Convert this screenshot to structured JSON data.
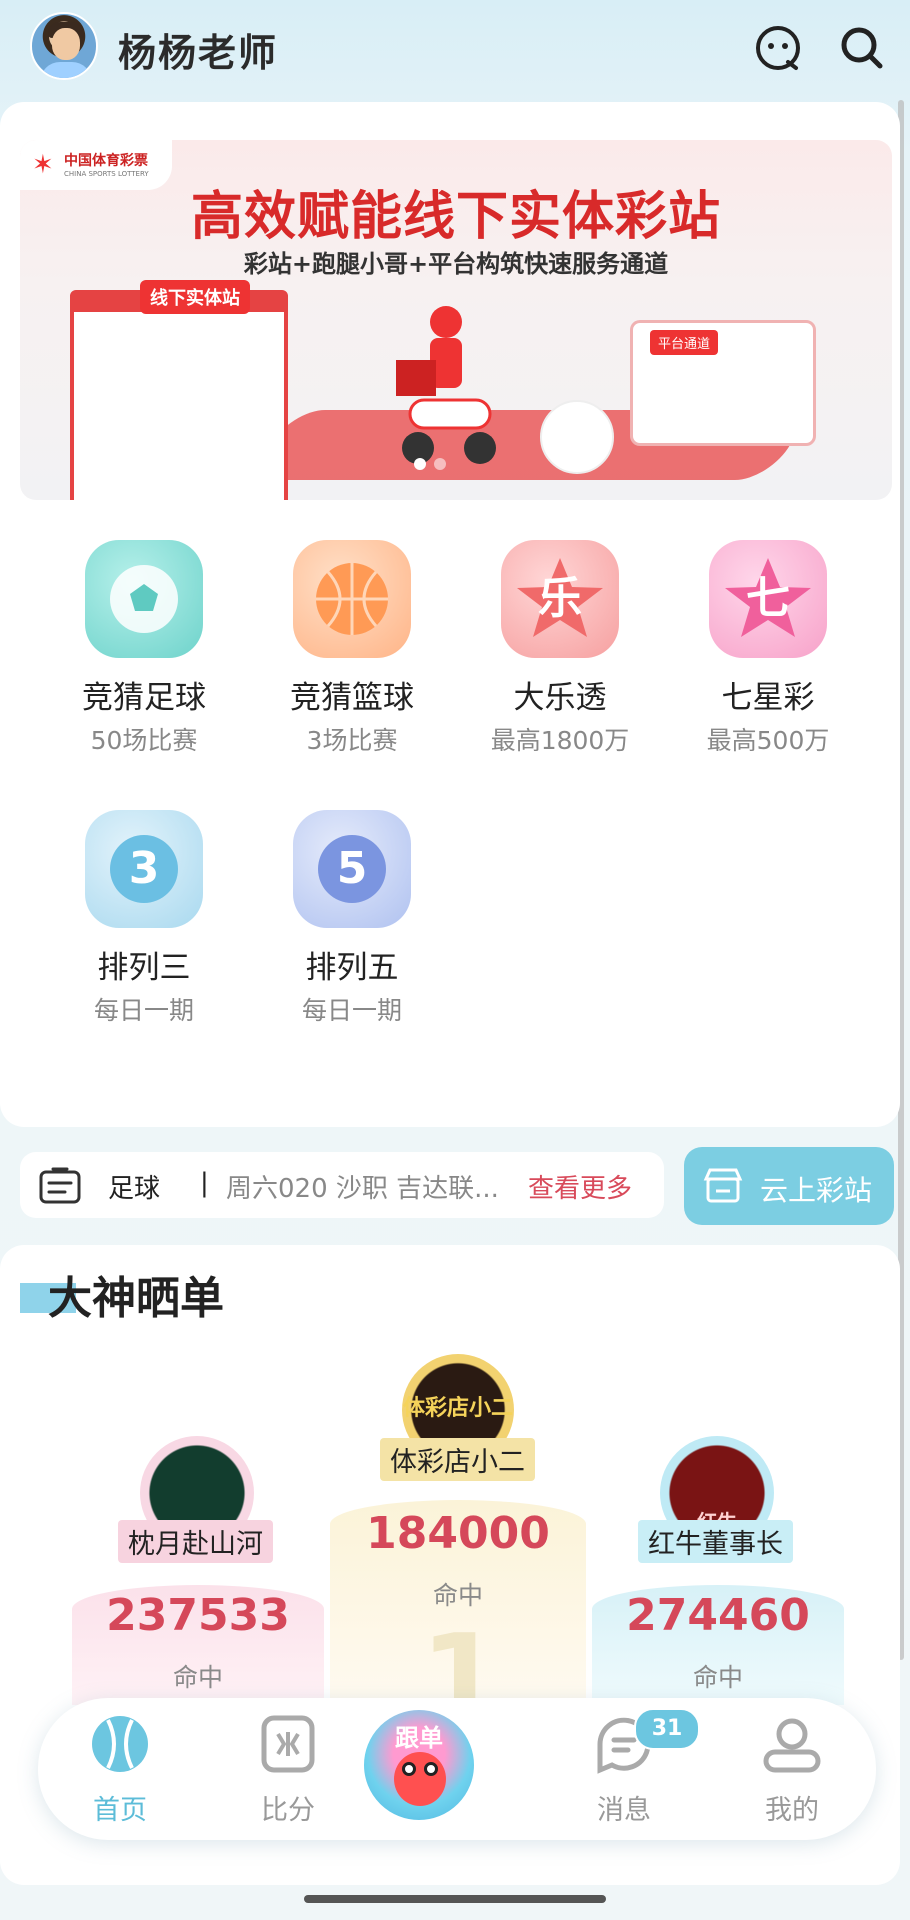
{
  "header": {
    "title": "杨杨老师"
  },
  "banner": {
    "logo_text": "中国体育彩票",
    "logo_sub": "CHINA SPORTS LOTTERY",
    "headline": "高效赋能线下实体彩站",
    "subline": "彩站+跑腿小哥+平台构筑快速服务通道",
    "kiosk_label": "线下实体站",
    "platform_label": "平台通道",
    "active_dot": 1,
    "dot_count": 2
  },
  "games": [
    {
      "name": "竞猜足球",
      "sub": "50场比赛",
      "icon": "soccer-icon",
      "color": "#7ad9d2"
    },
    {
      "name": "竞猜篮球",
      "sub": "3场比赛",
      "icon": "basketball-icon",
      "color": "#ffb27a"
    },
    {
      "name": "大乐透",
      "sub": "最高1800万",
      "icon": "dlt-star-icon",
      "glyph": "乐",
      "color": "#f58a8a"
    },
    {
      "name": "七星彩",
      "sub": "最高500万",
      "icon": "qxc-star-icon",
      "glyph": "七",
      "color": "#f58ab8"
    },
    {
      "name": "排列三",
      "sub": "每日一期",
      "icon": "pl3-ball-icon",
      "glyph": "3",
      "color": "#8fcdeb"
    },
    {
      "name": "排列五",
      "sub": "每日一期",
      "icon": "pl5-ball-icon",
      "glyph": "5",
      "color": "#8fa8e8"
    }
  ],
  "notice": {
    "label": "足球",
    "separator": "|",
    "text": "周六020 沙职 吉达联...",
    "more": "查看更多"
  },
  "cloud_button": {
    "label": "云上彩站"
  },
  "section": {
    "title": "大神晒单"
  },
  "leaders": {
    "left": {
      "name": "枕月赴山河",
      "score": "237533",
      "hit": "命中"
    },
    "middle": {
      "name": "体彩店小二",
      "score": "184000",
      "hit": "命中",
      "rank": "1",
      "avatar_text": "体彩店小二"
    },
    "right": {
      "name": "红牛董事长",
      "score": "274460",
      "hit": "命中",
      "avatar_text": "红牛"
    }
  },
  "tabbar": {
    "home": "首页",
    "score": "比分",
    "follow": "跟单",
    "messages": "消息",
    "messages_badge": "31",
    "mine": "我的",
    "active": "home",
    "active_color": "#5cbcd8"
  }
}
